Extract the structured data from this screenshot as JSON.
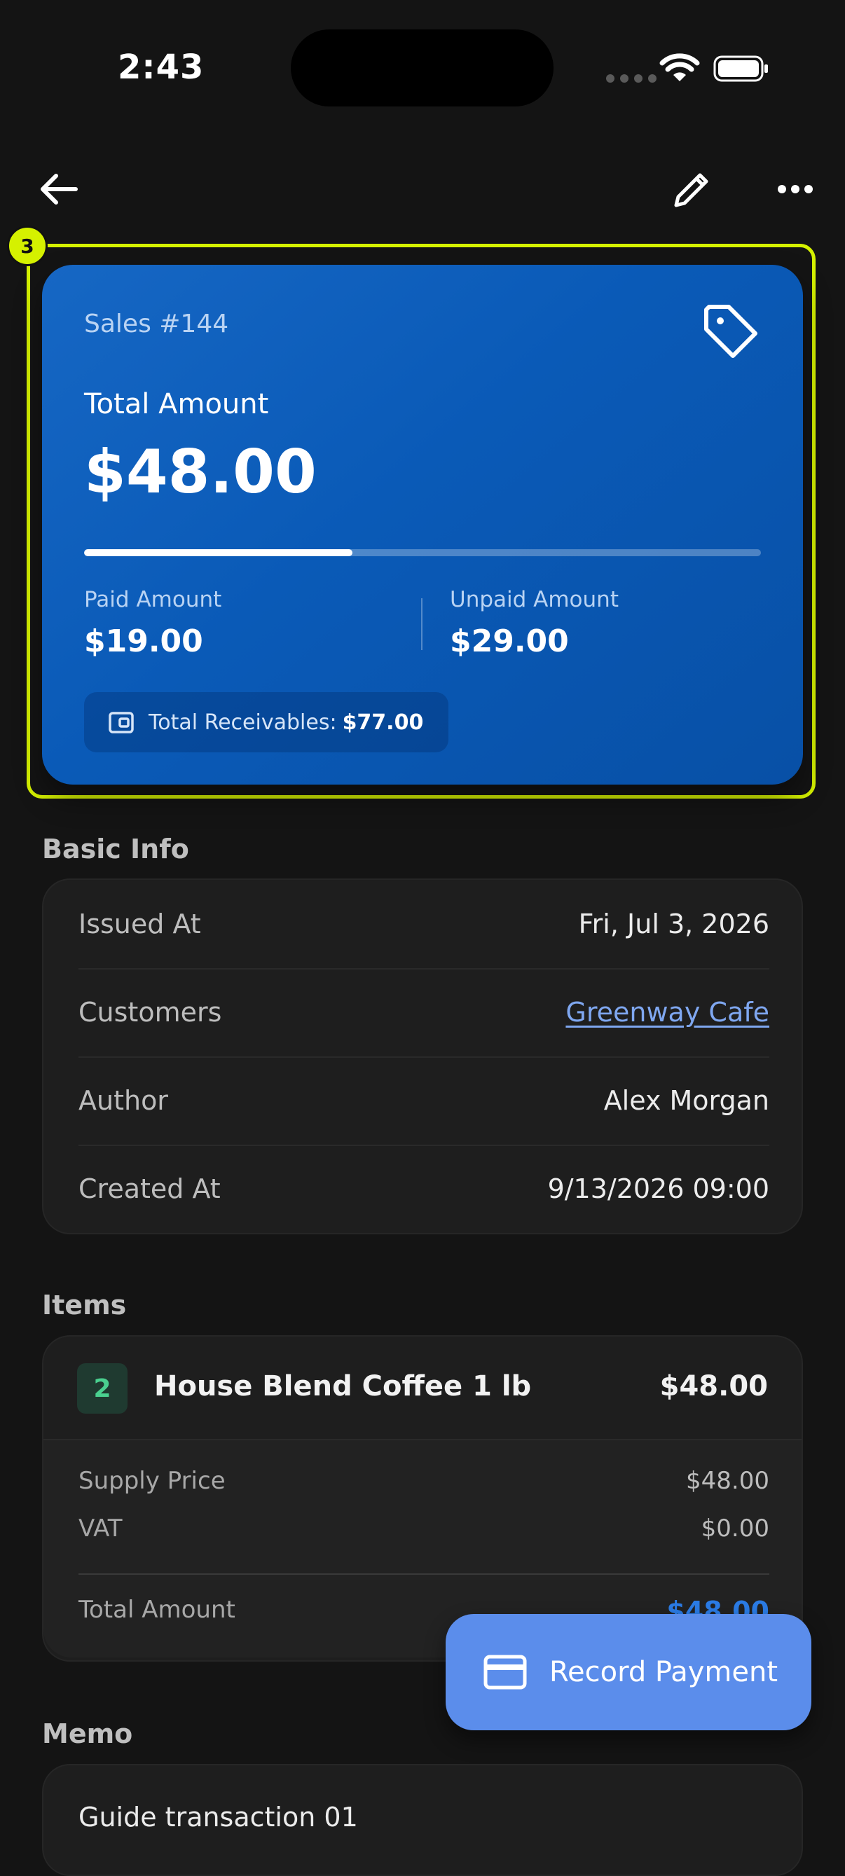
{
  "status_bar": {
    "time": "2:43"
  },
  "nav": {
    "back_icon": "arrow-left-icon",
    "edit_icon": "pencil-icon",
    "more_icon": "more-horizontal-icon"
  },
  "annotation": {
    "badge_number": "3",
    "highlight_color": "#D5F100"
  },
  "summary": {
    "sales_number": "Sales #144",
    "total_label": "Total Amount",
    "total_value": "$48.00",
    "paid_fraction": 0.396,
    "paid_label": "Paid Amount",
    "paid_value": "$19.00",
    "unpaid_label": "Unpaid Amount",
    "unpaid_value": "$29.00",
    "receivables_label": "Total Receivables:",
    "receivables_value": "$77.00",
    "card_color": "#0a5ab7"
  },
  "basic_info": {
    "title": "Basic Info",
    "rows": [
      {
        "label": "Issued At",
        "value": "Fri, Jul 3, 2026"
      },
      {
        "label": "Customers",
        "value": "Greenway Cafe"
      },
      {
        "label": "Author",
        "value": "Alex Morgan"
      },
      {
        "label": "Created At",
        "value": "9/13/2026 09:00"
      }
    ]
  },
  "items": {
    "title": "Items",
    "list": [
      {
        "quantity": "2",
        "name": "House Blend Coffee 1 lb",
        "price": "$48.00",
        "supply_price_label": "Supply Price",
        "supply_price": "$48.00",
        "vat_label": "VAT",
        "vat": "$0.00",
        "total_label": "Total Amount",
        "total": "$48.00"
      }
    ]
  },
  "memo": {
    "title": "Memo",
    "text": "Guide transaction 01"
  },
  "fab": {
    "label": "Record Payment",
    "color": "#5B8DEB"
  }
}
